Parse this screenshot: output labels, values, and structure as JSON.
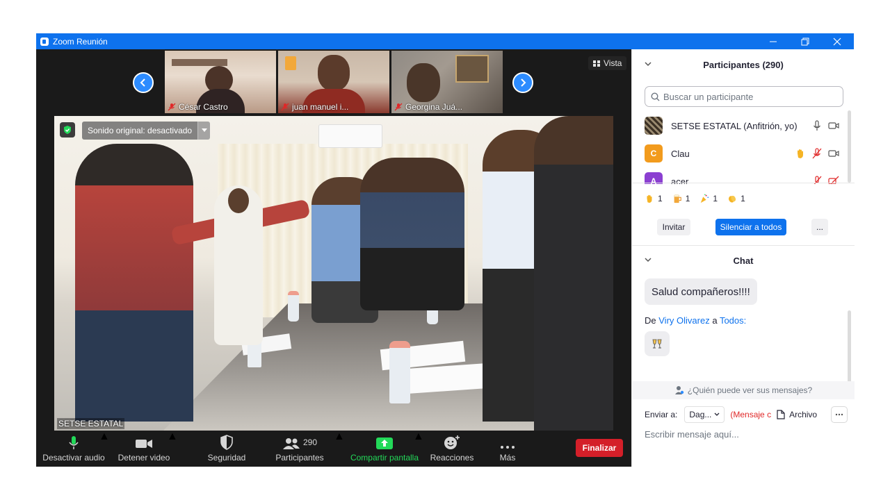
{
  "window": {
    "title": "Zoom Reunión"
  },
  "view_button": {
    "label": "Vista"
  },
  "thumbnails": [
    {
      "name": "César Castro"
    },
    {
      "name": "juan manuel i..."
    },
    {
      "name": "Georgina Juá..."
    }
  ],
  "main_video": {
    "sound_original": "Sonido original: desactivado",
    "speaker": "SETSE ESTATAL"
  },
  "toolbar": {
    "mute": "Desactivar audio",
    "video": "Detener video",
    "security": "Seguridad",
    "participants": "Participantes",
    "participants_count": "290",
    "share": "Compartir pantalla",
    "reactions": "Reacciones",
    "more": "Más",
    "end": "Finalizar"
  },
  "participants_panel": {
    "title": "Participantes (290)",
    "search_placeholder": "Buscar un participante",
    "list": [
      {
        "name": "SETSE ESTATAL (Anfitrión, yo)",
        "avatar": "",
        "avatar_color": "#6b5a3e"
      },
      {
        "name": "Clau",
        "avatar": "C",
        "avatar_color": "#f29b1d"
      },
      {
        "name": "acer",
        "avatar": "A",
        "avatar_color": "#8b3fd1"
      }
    ],
    "reaction_counts": [
      {
        "icon": "raised-hand",
        "count": "1"
      },
      {
        "icon": "beer",
        "count": "1"
      },
      {
        "icon": "party-popper",
        "count": "1"
      },
      {
        "icon": "clapping-hands",
        "count": "1"
      }
    ],
    "invite": "Invitar",
    "mute_all": "Silenciar a todos",
    "more": "..."
  },
  "chat_panel": {
    "title": "Chat",
    "message": "Salud compañeros!!!!",
    "from_prefix": "De",
    "from_sender": "Viry Olivarez",
    "from_mid": "a",
    "from_target": "Todos:",
    "emoji_message": "clinking-glasses",
    "who_can_see": "¿Quién puede ver sus mensajes?",
    "send_to_label": "Enviar a:",
    "send_to_value": "Dag...",
    "privacy_note": "(Mensaje c",
    "file_label": "Archivo",
    "input_placeholder": "Escribir mensaje aquí..."
  },
  "colors": {
    "zoom_blue": "#0e72ed",
    "end_red": "#d41f29",
    "share_green": "#23d959",
    "mute_red": "#e02828"
  }
}
